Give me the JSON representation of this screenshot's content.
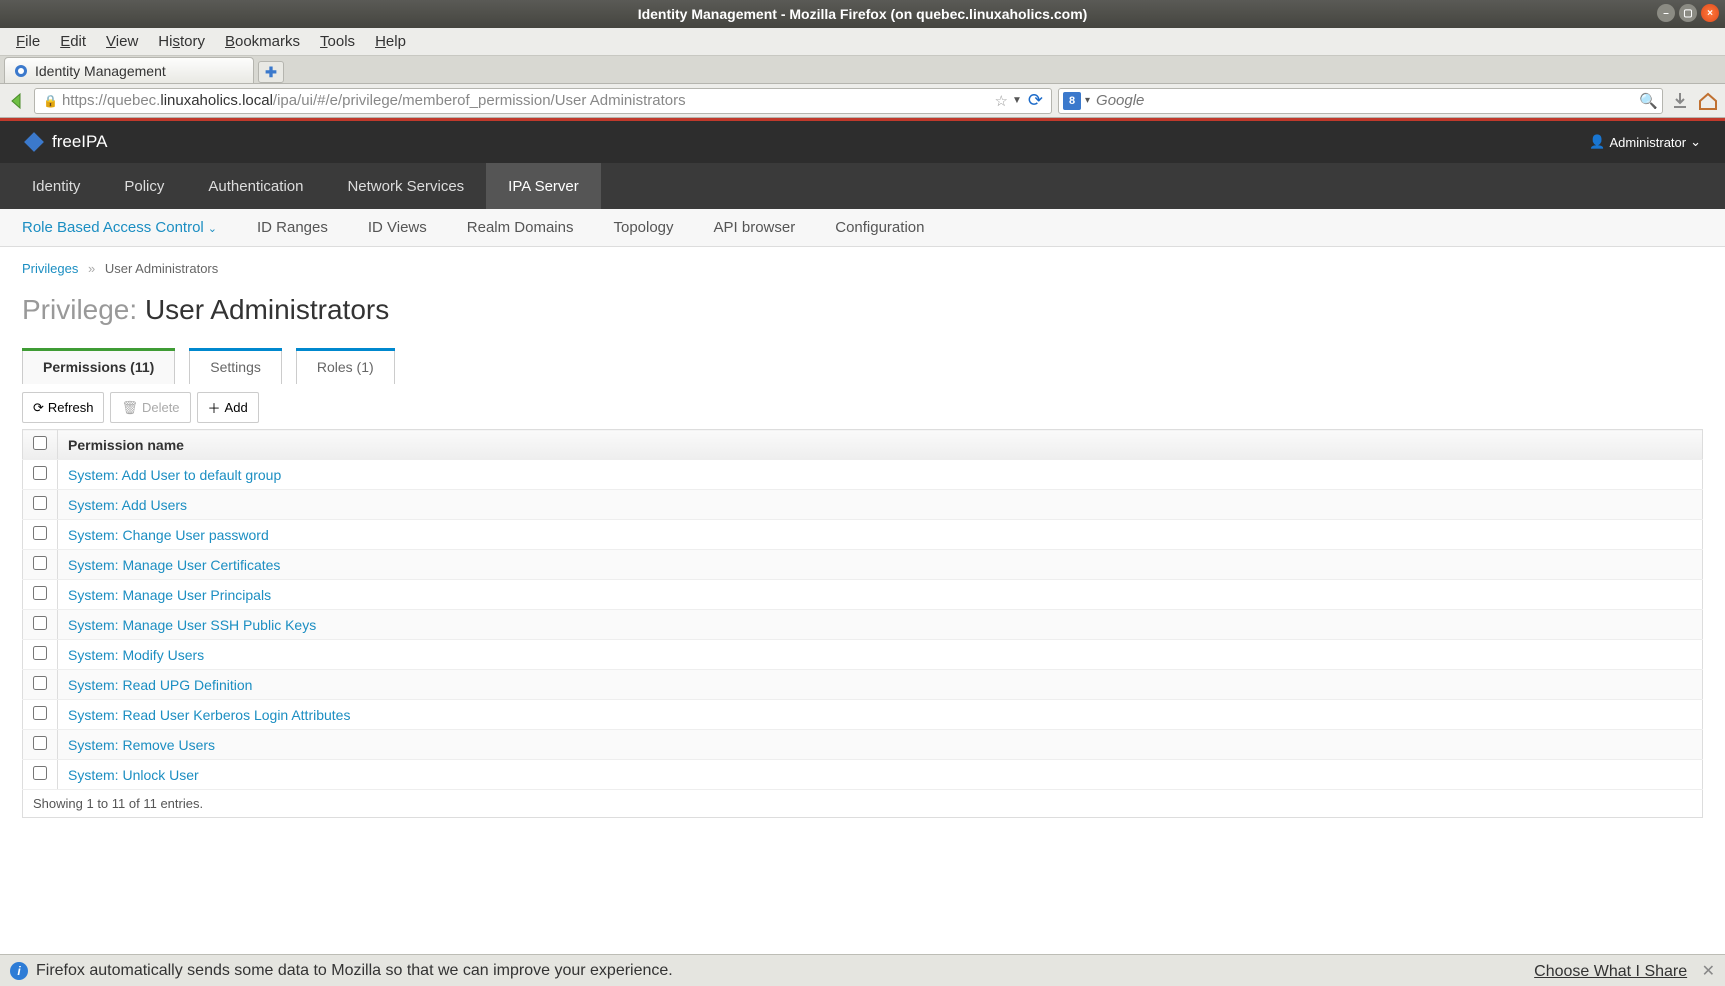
{
  "window": {
    "title": "Identity Management - Mozilla Firefox (on quebec.linuxaholics.com)"
  },
  "menubar": {
    "items": [
      "File",
      "Edit",
      "View",
      "History",
      "Bookmarks",
      "Tools",
      "Help"
    ]
  },
  "browser_tab": {
    "label": "Identity Management"
  },
  "urlbar": {
    "prefix": "https://quebec.",
    "host": "linuxaholics.local",
    "suffix": "/ipa/ui/#/e/privilege/memberof_permission/User Administrators"
  },
  "searchbox": {
    "placeholder": "Google"
  },
  "ipa": {
    "brand": "freeIPA",
    "user_label": "Administrator",
    "primary_nav": [
      {
        "label": "Identity",
        "active": false
      },
      {
        "label": "Policy",
        "active": false
      },
      {
        "label": "Authentication",
        "active": false
      },
      {
        "label": "Network Services",
        "active": false
      },
      {
        "label": "IPA Server",
        "active": true
      }
    ],
    "sub_nav": [
      {
        "label": "Role Based Access Control",
        "active": true,
        "caret": true
      },
      {
        "label": "ID Ranges",
        "active": false
      },
      {
        "label": "ID Views",
        "active": false
      },
      {
        "label": "Realm Domains",
        "active": false
      },
      {
        "label": "Topology",
        "active": false
      },
      {
        "label": "API browser",
        "active": false
      },
      {
        "label": "Configuration",
        "active": false
      }
    ]
  },
  "breadcrumb": {
    "link": "Privileges",
    "current": "User Administrators"
  },
  "page_title": {
    "prefix": "Privilege: ",
    "name": "User Administrators"
  },
  "facet_tabs": [
    {
      "label": "Permissions (11)",
      "color": "green",
      "active": true
    },
    {
      "label": "Settings",
      "color": "blue",
      "active": false
    },
    {
      "label": "Roles (1)",
      "color": "blue",
      "active": false
    }
  ],
  "actions": {
    "refresh": "Refresh",
    "delete": "Delete",
    "add": "Add"
  },
  "table": {
    "header": "Permission name",
    "rows": [
      "System: Add User to default group",
      "System: Add Users",
      "System: Change User password",
      "System: Manage User Certificates",
      "System: Manage User Principals",
      "System: Manage User SSH Public Keys",
      "System: Modify Users",
      "System: Read UPG Definition",
      "System: Read User Kerberos Login Attributes",
      "System: Remove Users",
      "System: Unlock User"
    ],
    "footer": "Showing 1 to 11 of 11 entries."
  },
  "statusbar": {
    "message": "Firefox automatically sends some data to Mozilla so that we can improve your experience.",
    "choose": "Choose What I Share"
  }
}
